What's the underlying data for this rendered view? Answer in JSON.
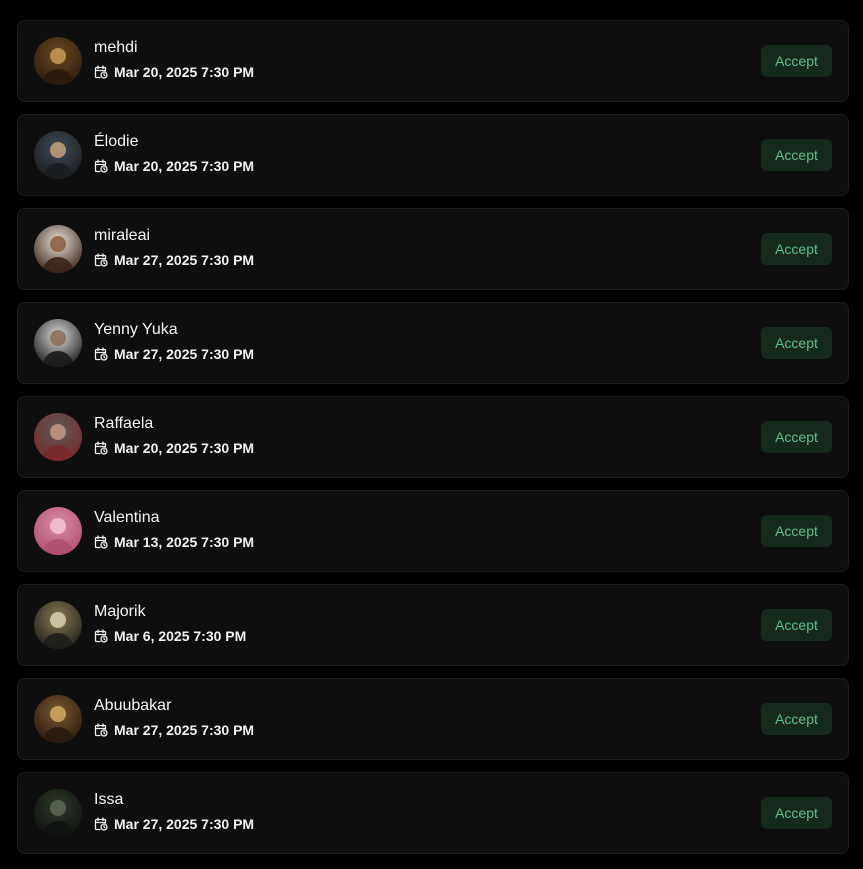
{
  "requests": [
    {
      "name": "mehdi",
      "date": "Mar 20, 2025 7:30 PM",
      "accept_label": "Accept",
      "avatar_colors": [
        "#6b4a22",
        "#2a1b0e",
        "#c89a55"
      ]
    },
    {
      "name": "Élodie",
      "date": "Mar 20, 2025 7:30 PM",
      "accept_label": "Accept",
      "avatar_colors": [
        "#3f4a55",
        "#1a1d20",
        "#c9a07a"
      ]
    },
    {
      "name": "miraleai",
      "date": "Mar 27, 2025 7:30 PM",
      "accept_label": "Accept",
      "avatar_colors": [
        "#e8e2dc",
        "#3a2418",
        "#8a5a3a"
      ]
    },
    {
      "name": "Yenny Yuka",
      "date": "Mar 27, 2025 7:30 PM",
      "accept_label": "Accept",
      "avatar_colors": [
        "#dcdcdc",
        "#1a1a1a",
        "#8a6a55"
      ]
    },
    {
      "name": "Raffaela",
      "date": "Mar 20, 2025 7:30 PM",
      "accept_label": "Accept",
      "avatar_colors": [
        "#5a5a5a",
        "#7a2a2a",
        "#c49a80"
      ]
    },
    {
      "name": "Valentina",
      "date": "Mar 13, 2025 7:30 PM",
      "accept_label": "Accept",
      "avatar_colors": [
        "#d98aa8",
        "#b0506e",
        "#f2c4d3"
      ]
    },
    {
      "name": "Majorik",
      "date": "Mar 6, 2025 7:30 PM",
      "accept_label": "Accept",
      "avatar_colors": [
        "#8a7a55",
        "#1e1e1a",
        "#d8d0b0"
      ]
    },
    {
      "name": "Abuubakar",
      "date": "Mar 27, 2025 7:30 PM",
      "accept_label": "Accept",
      "avatar_colors": [
        "#7a5a30",
        "#2a1a0e",
        "#d4a860"
      ]
    },
    {
      "name": "Issa",
      "date": "Mar 27, 2025 7:30 PM",
      "accept_label": "Accept",
      "avatar_colors": [
        "#2e3a2a",
        "#0e120e",
        "#5a6a55"
      ]
    }
  ],
  "icons": {
    "date": "calendar-clock-icon"
  },
  "colors": {
    "accept_bg": "#16291d",
    "accept_text": "#5cc08a",
    "card_bg": "#0e0e0e",
    "card_border": "#1f1f1f"
  }
}
